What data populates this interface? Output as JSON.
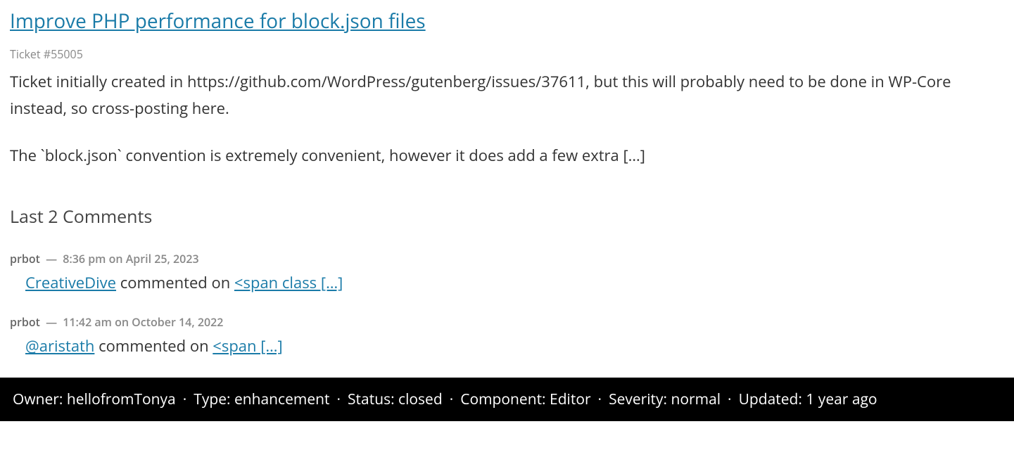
{
  "ticket": {
    "title": "Improve PHP performance for block.json files",
    "number_label": "Ticket #55005",
    "description_p1": "Ticket initially created in https://github.com/WordPress/gutenberg/issues/37611, but this will probably need to be done in WP-Core instead, so cross-posting here.",
    "description_p2": "The `block.json` convention is extremely convenient, however it does add a few extra […]"
  },
  "comments": {
    "heading": "Last 2 Comments",
    "items": [
      {
        "author": "prbot",
        "sep": " — ",
        "time": "8:36 pm on April 25, 2023",
        "user_link": "CreativeDive",
        "middle_text": " commented on ",
        "snippet_link": "<span class […]"
      },
      {
        "author": "prbot",
        "sep": " — ",
        "time": "11:42 am on October 14, 2022",
        "user_link": "@aristath",
        "middle_text": " commented on ",
        "snippet_link": "<span […]"
      }
    ]
  },
  "footer": {
    "owner": "Owner: hellofromTonya",
    "type": "Type: enhancement",
    "status": "Status: closed",
    "component": "Component: Editor",
    "severity": "Severity: normal",
    "updated": "Updated: 1 year ago",
    "dot": "·"
  }
}
